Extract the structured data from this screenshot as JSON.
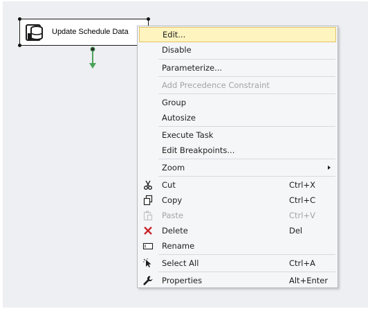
{
  "task": {
    "title": "Update Schedule Data",
    "icon": "sql-task-icon"
  },
  "colors": {
    "canvas": "#eeeff2",
    "highlight": "#fdf4bf",
    "success_connector": "#4aa35a",
    "delete_red": "#c8242a"
  },
  "menu": {
    "items": [
      {
        "label": "Edit...",
        "shortcut": "",
        "icon": "",
        "enabled": true,
        "highlighted": true
      },
      {
        "label": "Disable",
        "shortcut": "",
        "icon": "",
        "enabled": true
      },
      {
        "label": "Parameterize...",
        "shortcut": "",
        "icon": "",
        "enabled": true
      },
      {
        "label": "Add Precedence Constraint",
        "shortcut": "",
        "icon": "",
        "enabled": false
      },
      {
        "label": "Group",
        "shortcut": "",
        "icon": "",
        "enabled": true
      },
      {
        "label": "Autosize",
        "shortcut": "",
        "icon": "",
        "enabled": true
      },
      {
        "label": "Execute Task",
        "shortcut": "",
        "icon": "",
        "enabled": true
      },
      {
        "label": "Edit Breakpoints...",
        "shortcut": "",
        "icon": "",
        "enabled": true
      },
      {
        "label": "Zoom",
        "shortcut": "",
        "icon": "submenu-arrow-icon",
        "enabled": true
      },
      {
        "label": "Cut",
        "shortcut": "Ctrl+X",
        "icon": "scissors-icon",
        "enabled": true
      },
      {
        "label": "Copy",
        "shortcut": "Ctrl+C",
        "icon": "copy-icon",
        "enabled": true
      },
      {
        "label": "Paste",
        "shortcut": "Ctrl+V",
        "icon": "paste-icon",
        "enabled": false
      },
      {
        "label": "Delete",
        "shortcut": "Del",
        "icon": "delete-x-icon",
        "enabled": true
      },
      {
        "label": "Rename",
        "shortcut": "",
        "icon": "rename-icon",
        "enabled": true
      },
      {
        "label": "Select All",
        "shortcut": "Ctrl+A",
        "icon": "select-all-icon",
        "enabled": true
      },
      {
        "label": "Properties",
        "shortcut": "Alt+Enter",
        "icon": "wrench-icon",
        "enabled": true
      }
    ]
  }
}
